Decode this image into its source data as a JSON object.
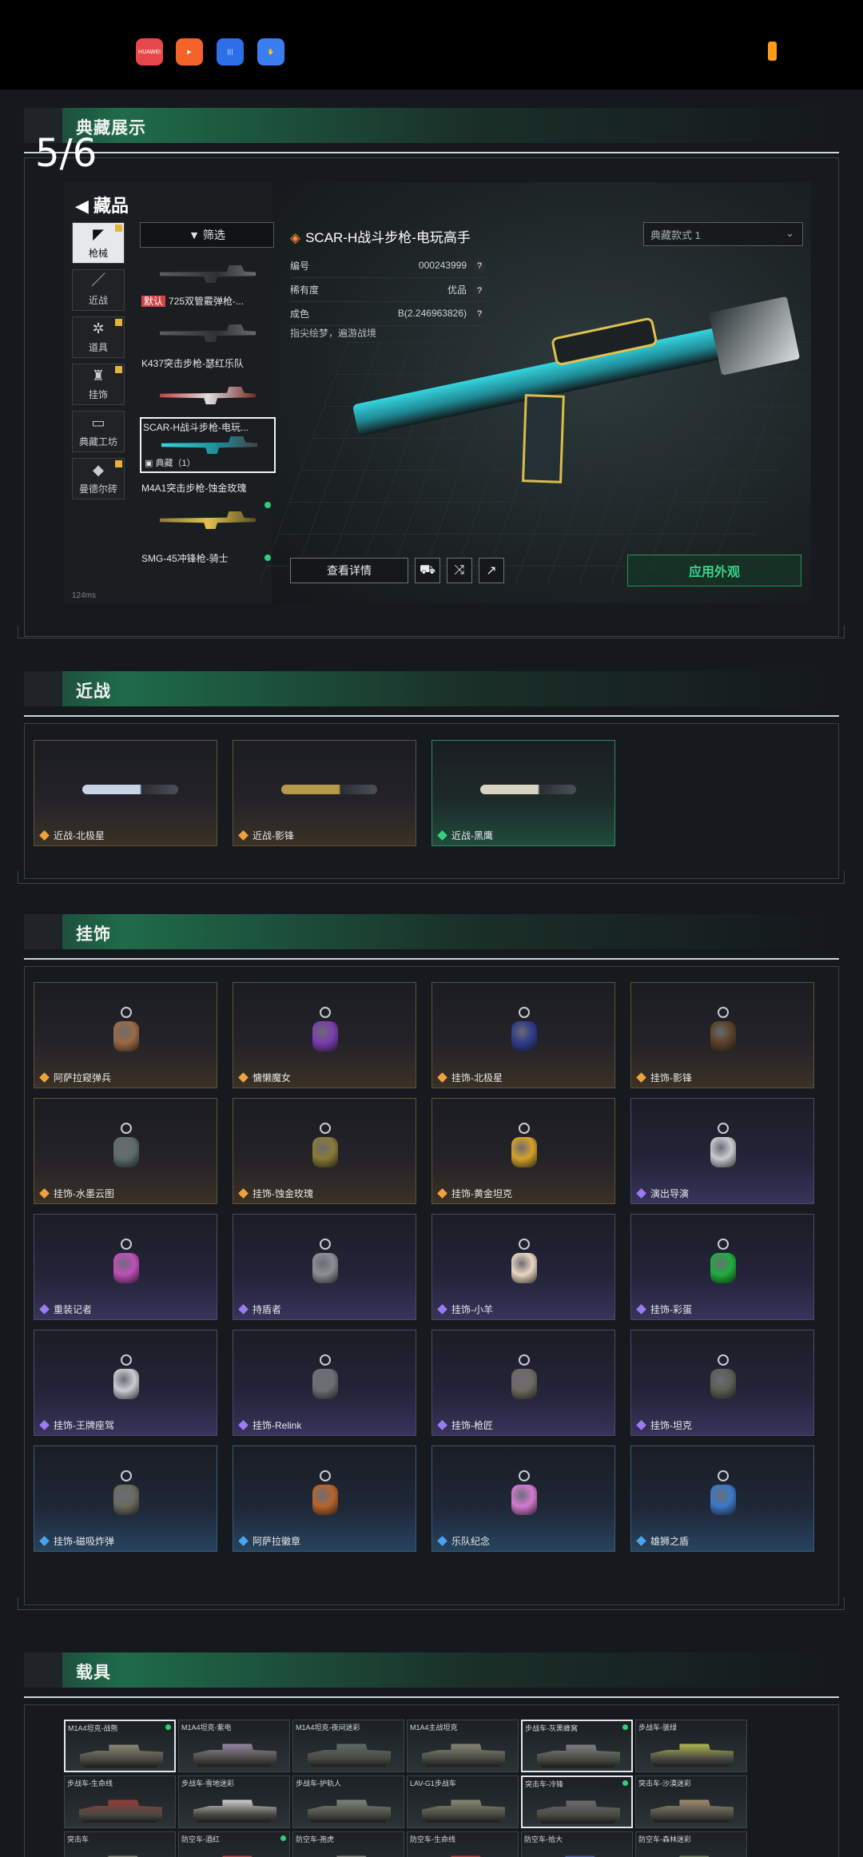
{
  "status_bar": {
    "apps": [
      {
        "label": "HUAWEI",
        "icon": "huawei-app-icon"
      },
      {
        "label": "",
        "icon": "kuaishou-app-icon"
      },
      {
        "label": "",
        "icon": "voice-app-icon"
      },
      {
        "label": "",
        "icon": "hand-app-icon"
      }
    ]
  },
  "page_indicator": "5/6",
  "sections": {
    "showcase": {
      "title": "典藏展示"
    },
    "melee": {
      "title": "近战"
    },
    "charms": {
      "title": "挂饰"
    },
    "vehicles": {
      "title": "载具"
    }
  },
  "game": {
    "header": "藏品",
    "tabs": [
      {
        "label": "枪械",
        "glyph": "◤",
        "active": true,
        "badge": true
      },
      {
        "label": "近战",
        "glyph": "／",
        "active": false,
        "badge": false
      },
      {
        "label": "道具",
        "glyph": "✲",
        "active": false,
        "badge": true
      },
      {
        "label": "挂饰",
        "glyph": "♜",
        "active": false,
        "badge": true
      },
      {
        "label": "典藏工坊",
        "glyph": "▭",
        "active": false,
        "badge": false
      },
      {
        "label": "曼德尔砖",
        "glyph": "◆",
        "active": false,
        "badge": true
      }
    ],
    "filter_label": "筛选",
    "list": [
      {
        "label": "",
        "tag": "",
        "sub": ""
      },
      {
        "label": "725双管霰弹枪-...",
        "tag": "默认",
        "sub": ""
      },
      {
        "label": "K437突击步枪-瑟红乐队",
        "tag": "",
        "sub": ""
      },
      {
        "label": "SCAR-H战斗步枪-电玩...",
        "tag": "",
        "sub": "典藏（1）",
        "selected": true
      },
      {
        "label": "M4A1突击步枪-蚀金玫瑰",
        "tag": "",
        "sub": "",
        "dot": true
      },
      {
        "label": "SMG-45冲锋枪-骑士",
        "tag": "",
        "sub": "",
        "dot": true
      }
    ],
    "weapon_title": "SCAR-H战斗步枪-电玩高手",
    "props": [
      {
        "key": "编号",
        "value": "000243999"
      },
      {
        "key": "稀有度",
        "value": "优品"
      },
      {
        "key": "成色",
        "value": "B(2.246963826)"
      }
    ],
    "description": "指尖绘梦，遍游战境",
    "dropdown": "典藏款式 1",
    "detail_button": "查看详情",
    "apply_button": "应用外观",
    "ping": "124ms"
  },
  "melee_items": [
    {
      "name": "近战-北极星",
      "rarity": "gold",
      "style": "gold",
      "blade": "#c9d3e6"
    },
    {
      "name": "近战-影锋",
      "rarity": "gold",
      "style": "gold",
      "blade": "#b89a4a"
    },
    {
      "name": "近战-黑鹰",
      "rarity": "green",
      "style": "green",
      "blade": "#d9d3c2"
    }
  ],
  "charm_items": [
    {
      "name": "阿萨拉窥弹兵",
      "rarity": "gold",
      "style": "gold",
      "color": "#9a6a44"
    },
    {
      "name": "慵懒魔女",
      "rarity": "gold",
      "style": "gold",
      "color": "#7a3db0"
    },
    {
      "name": "挂饰-北极星",
      "rarity": "gold",
      "style": "gold",
      "color": "#2e3b8a"
    },
    {
      "name": "挂饰-影锋",
      "rarity": "gold",
      "style": "gold",
      "color": "#5a4128"
    },
    {
      "name": "挂饰-水墨云图",
      "rarity": "gold",
      "style": "gold",
      "color": "#5c6e6a"
    },
    {
      "name": "挂饰-蚀金玫瑰",
      "rarity": "gold",
      "style": "gold",
      "color": "#8a7a36"
    },
    {
      "name": "挂饰-黄金坦克",
      "rarity": "gold",
      "style": "gold",
      "color": "#d6a12a"
    },
    {
      "name": "演出导演",
      "rarity": "purple",
      "style": "purple",
      "color": "#c8cbd0"
    },
    {
      "name": "重装记者",
      "rarity": "purple",
      "style": "purple",
      "color": "#c04fb8"
    },
    {
      "name": "持盾者",
      "rarity": "purple",
      "style": "purple",
      "color": "#8c8f94"
    },
    {
      "name": "挂饰-小羊",
      "rarity": "purple",
      "style": "purple",
      "color": "#e8d7c0"
    },
    {
      "name": "挂饰-彩蛋",
      "rarity": "purple",
      "style": "purple",
      "color": "#1fae3c"
    },
    {
      "name": "挂饰-王牌座驾",
      "rarity": "purple",
      "style": "purple",
      "color": "#c9ccd0"
    },
    {
      "name": "挂饰-Relink",
      "rarity": "purple",
      "style": "purple",
      "color": "#6b6e72"
    },
    {
      "name": "挂饰-枪匠",
      "rarity": "purple",
      "style": "purple",
      "color": "#6f6a60"
    },
    {
      "name": "挂饰-坦克",
      "rarity": "purple",
      "style": "purple",
      "color": "#5a5e52"
    },
    {
      "name": "挂饰-磁吸炸弹",
      "rarity": "blue",
      "style": "blue",
      "color": "#6a6a5e"
    },
    {
      "name": "阿萨拉徽章",
      "rarity": "blue",
      "style": "blue",
      "color": "#b8642a"
    },
    {
      "name": "乐队纪念",
      "rarity": "blue",
      "style": "blue",
      "color": "#d47ad0"
    },
    {
      "name": "雄狮之盾",
      "rarity": "blue",
      "style": "blue",
      "color": "#3a78c8"
    }
  ],
  "vehicle_items": [
    {
      "label": "M1A4坦克-战熊",
      "selected": true,
      "dot": true
    },
    {
      "label": "M1A4坦克-紫电",
      "dot": false
    },
    {
      "label": "M1A4坦克-夜间迷彩",
      "dot": false
    },
    {
      "label": "M1A4主战坦克",
      "dot": false
    },
    {
      "label": "步战车-灰黑蜂窝",
      "selected": true,
      "dot": true
    },
    {
      "label": "步战车-骇绿",
      "dot": false
    },
    {
      "label": "步战车-生命线",
      "dot": false
    },
    {
      "label": "步战车-雪地迷彩",
      "dot": false
    },
    {
      "label": "步战车-护轨人",
      "dot": false
    },
    {
      "label": "LAV-G1步战车",
      "dot": false
    },
    {
      "label": "突击车-冷锋",
      "selected": true,
      "dot": true
    },
    {
      "label": "突击车-沙漠迷彩",
      "dot": false
    },
    {
      "label": "突击车",
      "dot": false
    },
    {
      "label": "防空车-酒红",
      "dot": true
    },
    {
      "label": "防空车-孢虎",
      "dot": false
    },
    {
      "label": "防空车-生命线",
      "dot": false
    },
    {
      "label": "防空车-拾大",
      "dot": false
    },
    {
      "label": "防空车-森林迷彩",
      "dot": false
    }
  ]
}
